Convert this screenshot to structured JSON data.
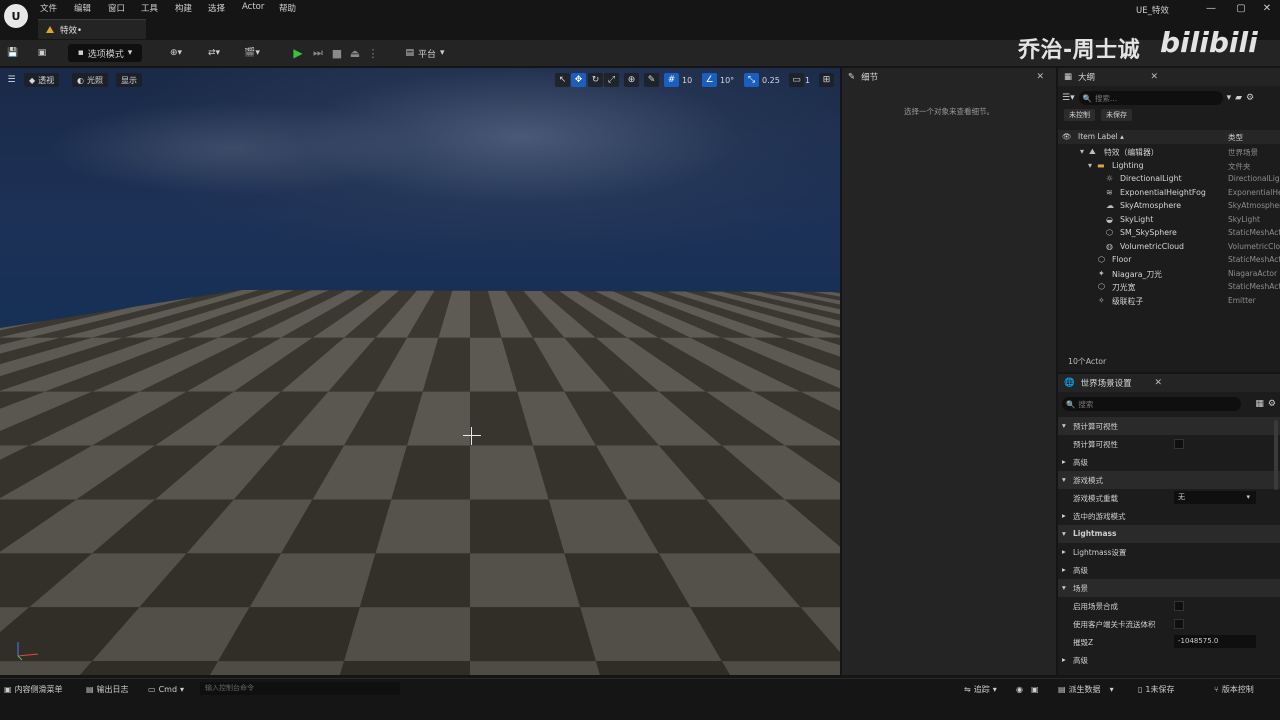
{
  "menu": [
    "文件",
    "编辑",
    "窗口",
    "工具",
    "构建",
    "选择",
    "Actor",
    "帮助"
  ],
  "document_tab": "特效•",
  "project_name": "UE_特效",
  "window_buttons": [
    "—",
    "▢",
    "✕"
  ],
  "watermark": {
    "author": "乔治-周士诚",
    "site": "bilibili"
  },
  "toolbar": {
    "mode_label": "选项模式",
    "platform_label": "平台"
  },
  "viewport": {
    "perspective_label": "透视",
    "lighting_label": "光照",
    "show_label": "显示",
    "grid_snap": "10",
    "rotation_snap": "10°",
    "scale_snap": "0.25",
    "camera_speed": "1"
  },
  "details": {
    "tab_label": "细节",
    "hint": "选择一个对象来查看细节。"
  },
  "outliner": {
    "tab_label": "大纲",
    "search_placeholder": "搜索...",
    "chip_uncontrolled": "未控制",
    "chip_unsaved": "未保存",
    "col_label": "Item Label ▴",
    "col_type": "类型",
    "items": [
      {
        "label": "特效（编辑器）",
        "type": "世界场景"
      },
      {
        "label": "Lighting",
        "type": "文件夹"
      },
      {
        "label": "DirectionalLight",
        "type": "DirectionalLight"
      },
      {
        "label": "ExponentialHeightFog",
        "type": "ExponentialHeightFog"
      },
      {
        "label": "SkyAtmosphere",
        "type": "SkyAtmosphere"
      },
      {
        "label": "SkyLight",
        "type": "SkyLight"
      },
      {
        "label": "SM_SkySphere",
        "type": "StaticMeshActor"
      },
      {
        "label": "VolumetricCloud",
        "type": "VolumetricCloud"
      },
      {
        "label": "Floor",
        "type": "StaticMeshActor"
      },
      {
        "label": "Niagara_刀光",
        "type": "NiagaraActor"
      },
      {
        "label": "刀光宽",
        "type": "StaticMeshActor"
      },
      {
        "label": "级联粒子",
        "type": "Emitter"
      }
    ],
    "actor_count": "10个Actor"
  },
  "world_settings": {
    "tab_label": "世界场景设置",
    "search_placeholder": "搜索",
    "rows": [
      {
        "label": "预计算可视性",
        "kind": "category"
      },
      {
        "label": "预计算可视性",
        "kind": "checkbox"
      },
      {
        "label": "高级",
        "kind": "sub"
      },
      {
        "label": "游戏模式",
        "kind": "category"
      },
      {
        "label": "游戏模式重载",
        "kind": "combo",
        "value": "无"
      },
      {
        "label": "选中的游戏模式",
        "kind": "sub"
      },
      {
        "label": "Lightmass",
        "kind": "category"
      },
      {
        "label": "Lightmass设置",
        "kind": "sub"
      },
      {
        "label": "高级",
        "kind": "sub"
      },
      {
        "label": "场景",
        "kind": "category"
      },
      {
        "label": "启用场景合成",
        "kind": "checkbox"
      },
      {
        "label": "使用客户端关卡流送体积",
        "kind": "checkbox"
      },
      {
        "label": "摧毁Z",
        "kind": "value",
        "value": "-1048575.0"
      },
      {
        "label": "高级",
        "kind": "sub"
      }
    ]
  },
  "statusbar": {
    "content_drawer": "内容侧滑菜单",
    "output_log": "输出日志",
    "cmd": "Cmd",
    "cmd_placeholder": "输入控制台命令",
    "trace": "追踪",
    "derived_data": "派生数据",
    "unsaved": "1未保存",
    "source_control": "版本控制"
  }
}
